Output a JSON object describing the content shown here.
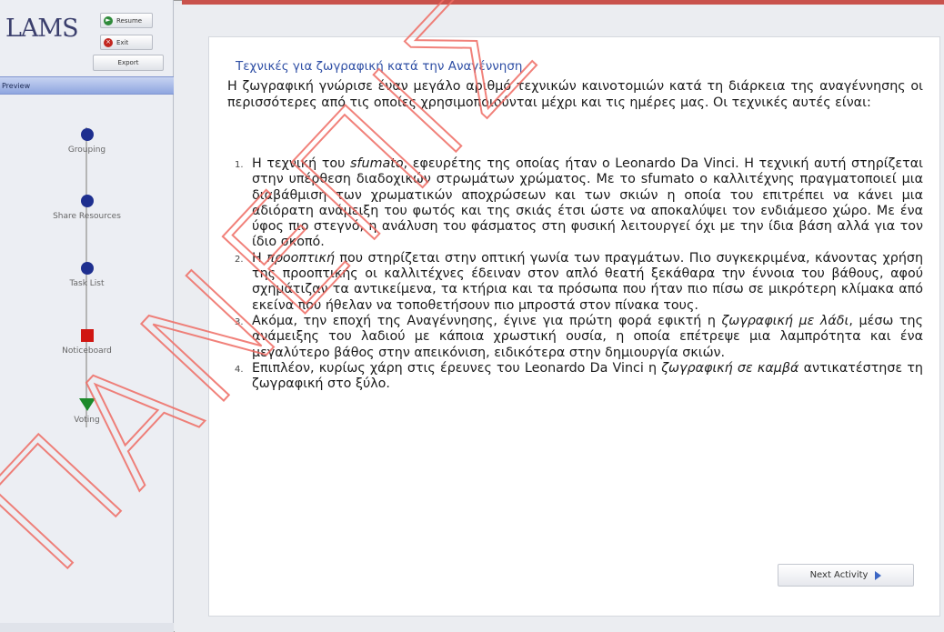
{
  "app": {
    "logo": "LAMS"
  },
  "controls": {
    "resume_label": "Resume",
    "exit_label": "Exit",
    "export_label": "Export",
    "preview_label": "Preview"
  },
  "sequence": {
    "activities": [
      {
        "label": "Grouping",
        "marker": "circle-blue",
        "status": "completed"
      },
      {
        "label": "Share Resources",
        "marker": "circle-blue",
        "status": "completed"
      },
      {
        "label": "Task List",
        "marker": "circle-blue",
        "status": "completed"
      },
      {
        "label": "Noticeboard",
        "marker": "square-red",
        "status": "current"
      },
      {
        "label": "Voting",
        "marker": "triangle-green",
        "status": "upcoming"
      }
    ]
  },
  "content": {
    "title": "Τεχνικές για ζωγραφική κατά την Αναγέννηση",
    "intro": "Η ζωγραφική γνώρισε έναν μεγάλο αριθμό τεχνικών καινοτομιών κατά τη διάρκεια της αναγέννησης οι περισσότερες από τις οποίες χρησιμοποιούνται μέχρι και τις ημέρες μας. Οι τεχνικές αυτές είναι:",
    "items": [
      {
        "num": "1.",
        "before": "Η τεχνική του ",
        "em": "sfumato",
        "after": ", εφευρέτης της οποίας ήταν ο Leonardo Da Vinci. Η τεχνική αυτή στηρίζεται στην υπέρθεση διαδοχικών στρωμάτων χρώματος. Με το sfumato ο καλλιτέχνης πραγματοποιεί μια διαβάθμιση των χρωματικών αποχρώσεων και των σκιών η οποία του επιτρέπει να κάνει μια αδιόρατη ανάμειξη του φωτός και της σκιάς έτσι ώστε να αποκαλύψει τον ενδιάμεσο χώρο. Με ένα ύφος πιο στεγνό, η ανάλυση του φάσματος στη φυσική λειτουργεί όχι με την ίδια βάση αλλά για τον ίδιο σκοπό."
      },
      {
        "num": "2.",
        "before": "Η ",
        "em": "προοπτική",
        "after": " που στηρίζεται στην οπτική γωνία των πραγμάτων. Πιο συγκεκριμένα, κάνοντας χρήση της προοπτικής οι καλλιτέχνες έδειναν στον απλό θεατή ξεκάθαρα την έννοια του βάθους, αφού σχημάτιζαν τα αντικείμενα, τα κτήρια και τα πρόσωπα που ήταν πιο πίσω σε μικρότερη κλίμακα από εκείνα που ήθελαν να τοποθετήσουν πιο μπροστά στον πίνακα τους."
      },
      {
        "num": "3.",
        "before": "Ακόμα, την εποχή της Αναγέννησης, έγινε για πρώτη φορά εφικτή η ",
        "em": "ζωγραφική με λάδι",
        "after": ", μέσω της ανάμειξης του λαδιού με κάποια χρωστική ουσία, η οποία επέτρεψε μια λαμπρότητα και ένα μεγαλύτερο βάθος στην απεικόνιση, ειδικότερα στην δημιουργία σκιών."
      },
      {
        "num": "4.",
        "before": "Επιπλέον, κυρίως χάρη στις έρευνες του Leonardo Da Vinci η ",
        "em": "ζωγραφική σε καμβά",
        "after": " αντικατέστησε τη ζωγραφική στο ξύλο."
      }
    ],
    "next_label": "Next Activity"
  },
  "watermark": {
    "text": "ΠΑΝΕΠΙΣ",
    "color": "#ee6b63"
  },
  "colors": {
    "title": "#2f4fa5",
    "preview_bar": "#8fa6e0",
    "completed": "#1e2f8f",
    "current": "#d01612",
    "upcoming": "#1c8a2a"
  }
}
